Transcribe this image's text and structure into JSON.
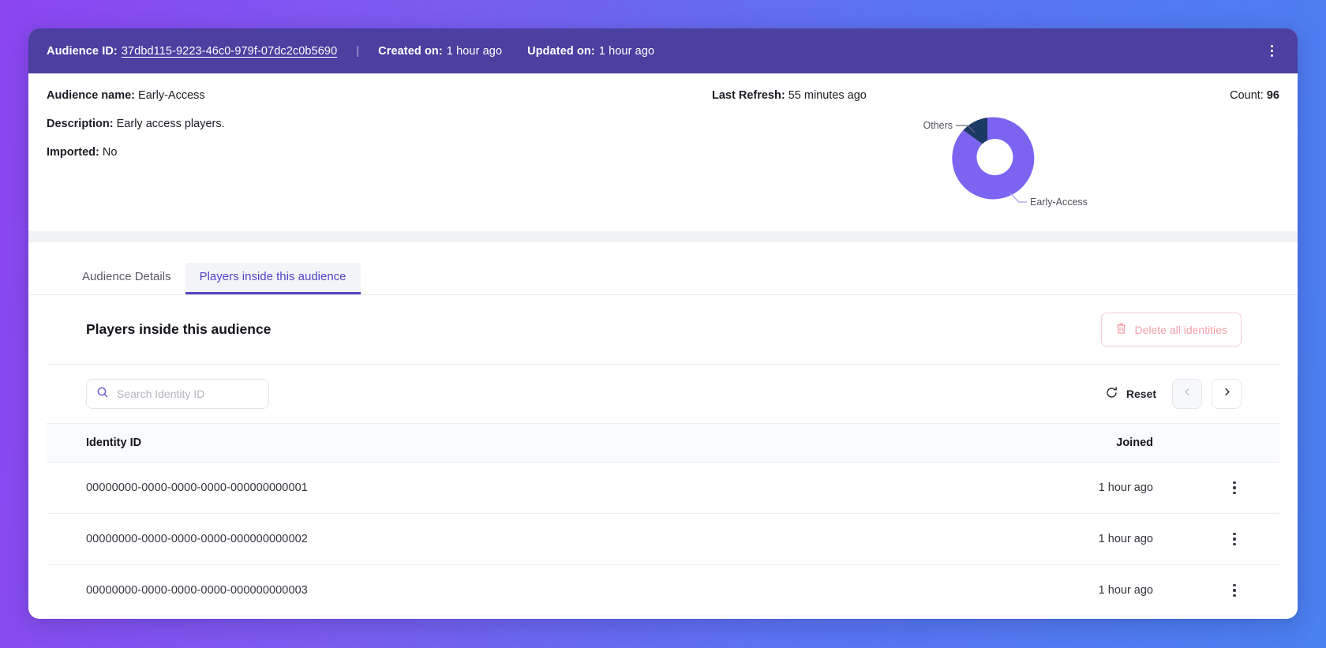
{
  "topbar": {
    "audience_id_label": "Audience ID:",
    "audience_id_value": "37dbd115-9223-46c0-979f-07dc2c0b5690",
    "separator": "|",
    "created_label": "Created on:",
    "created_value": "1 hour ago",
    "updated_label": "Updated on:",
    "updated_value": "1 hour ago",
    "menu_icon": "kebab-menu-icon",
    "bg_color": "#4B3FA0"
  },
  "summary": {
    "name_label": "Audience name:",
    "name_value": "Early-Access",
    "description_label": "Description:",
    "description_value": "Early access players.",
    "imported_label": "Imported:",
    "imported_value": "No",
    "last_refresh_label": "Last Refresh:",
    "last_refresh_value": "55 minutes ago",
    "count_label": "Count:",
    "count_value": "96"
  },
  "chart_data": {
    "type": "pie",
    "variant": "donut",
    "title": "",
    "labels": [
      "Early-Access",
      "Others"
    ],
    "values": [
      88,
      12
    ],
    "colors": [
      "#7C63F0",
      "#1B3A66"
    ],
    "legend": "callout-labels",
    "annotations": [
      {
        "text": "Others",
        "position": "top-left"
      },
      {
        "text": "Early-Access",
        "position": "bottom-right"
      }
    ]
  },
  "tabs": [
    {
      "label": "Audience Details",
      "active": false
    },
    {
      "label": "Players inside this audience",
      "active": true
    }
  ],
  "panel": {
    "title": "Players inside this audience",
    "delete_all_label": "Delete all identities",
    "delete_icon": "trash-icon",
    "delete_color": "#f2a0aa"
  },
  "toolbar": {
    "search_placeholder": "Search Identity ID",
    "search_value": "",
    "search_icon": "search-icon",
    "reset_label": "Reset",
    "reset_icon": "refresh-icon",
    "prev_icon": "chevron-left-icon",
    "next_icon": "chevron-right-icon"
  },
  "table": {
    "columns": [
      "Identity ID",
      "Joined"
    ],
    "rows": [
      {
        "identity_id": "00000000-0000-0000-0000-000000000001",
        "joined": "1 hour ago"
      },
      {
        "identity_id": "00000000-0000-0000-0000-000000000002",
        "joined": "1 hour ago"
      },
      {
        "identity_id": "00000000-0000-0000-0000-000000000003",
        "joined": "1 hour ago"
      }
    ],
    "row_menu_icon": "kebab-menu-icon"
  }
}
